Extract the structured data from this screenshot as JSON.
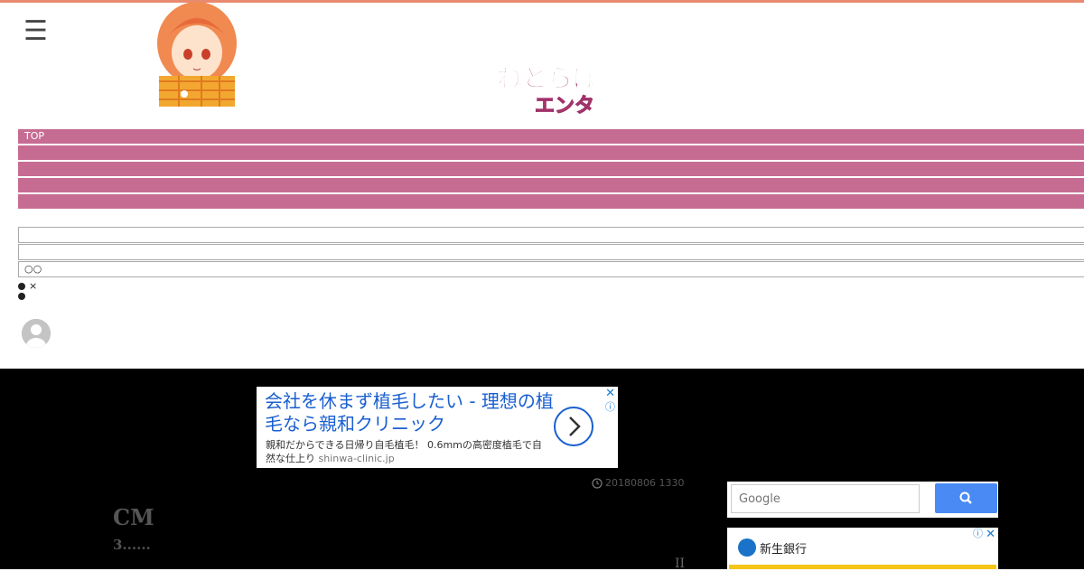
{
  "header": {
    "menu_icon": "hamburger-icon",
    "mascot_image": "anime-girl-mascot",
    "logo_text_top": "ねとらぼ",
    "logo_text_bottom": "エンタ"
  },
  "nav": {
    "items": [
      "TOP",
      "",
      "",
      "",
      ""
    ]
  },
  "subnav": {
    "rows": [
      "",
      "",
      "○○"
    ]
  },
  "bullets": [
    "×",
    ""
  ],
  "ad_top": {
    "headline": "会社を休まず植毛したい - 理想の植毛なら親和クリニック",
    "description": "親和だからできる日帰り自毛植毛！ 0.6mmの高密度植毛で自然な仕上り",
    "url": "shinwa-clinic.jp",
    "close": "✕",
    "info": "ⓘ"
  },
  "article": {
    "date": "20180806 1330",
    "title": "CM",
    "subtitle": "3......",
    "pager": "II"
  },
  "search": {
    "placeholder": "Google"
  },
  "ad_side": {
    "brand": "新生銀行",
    "close": "✕",
    "info": "ⓘ"
  },
  "colors": {
    "nav_bg": "#c66c92",
    "top_line": "#e88a70",
    "dark_bg": "#000000",
    "ad_blue": "#1a5fd0",
    "search_btn": "#4a8af4"
  }
}
